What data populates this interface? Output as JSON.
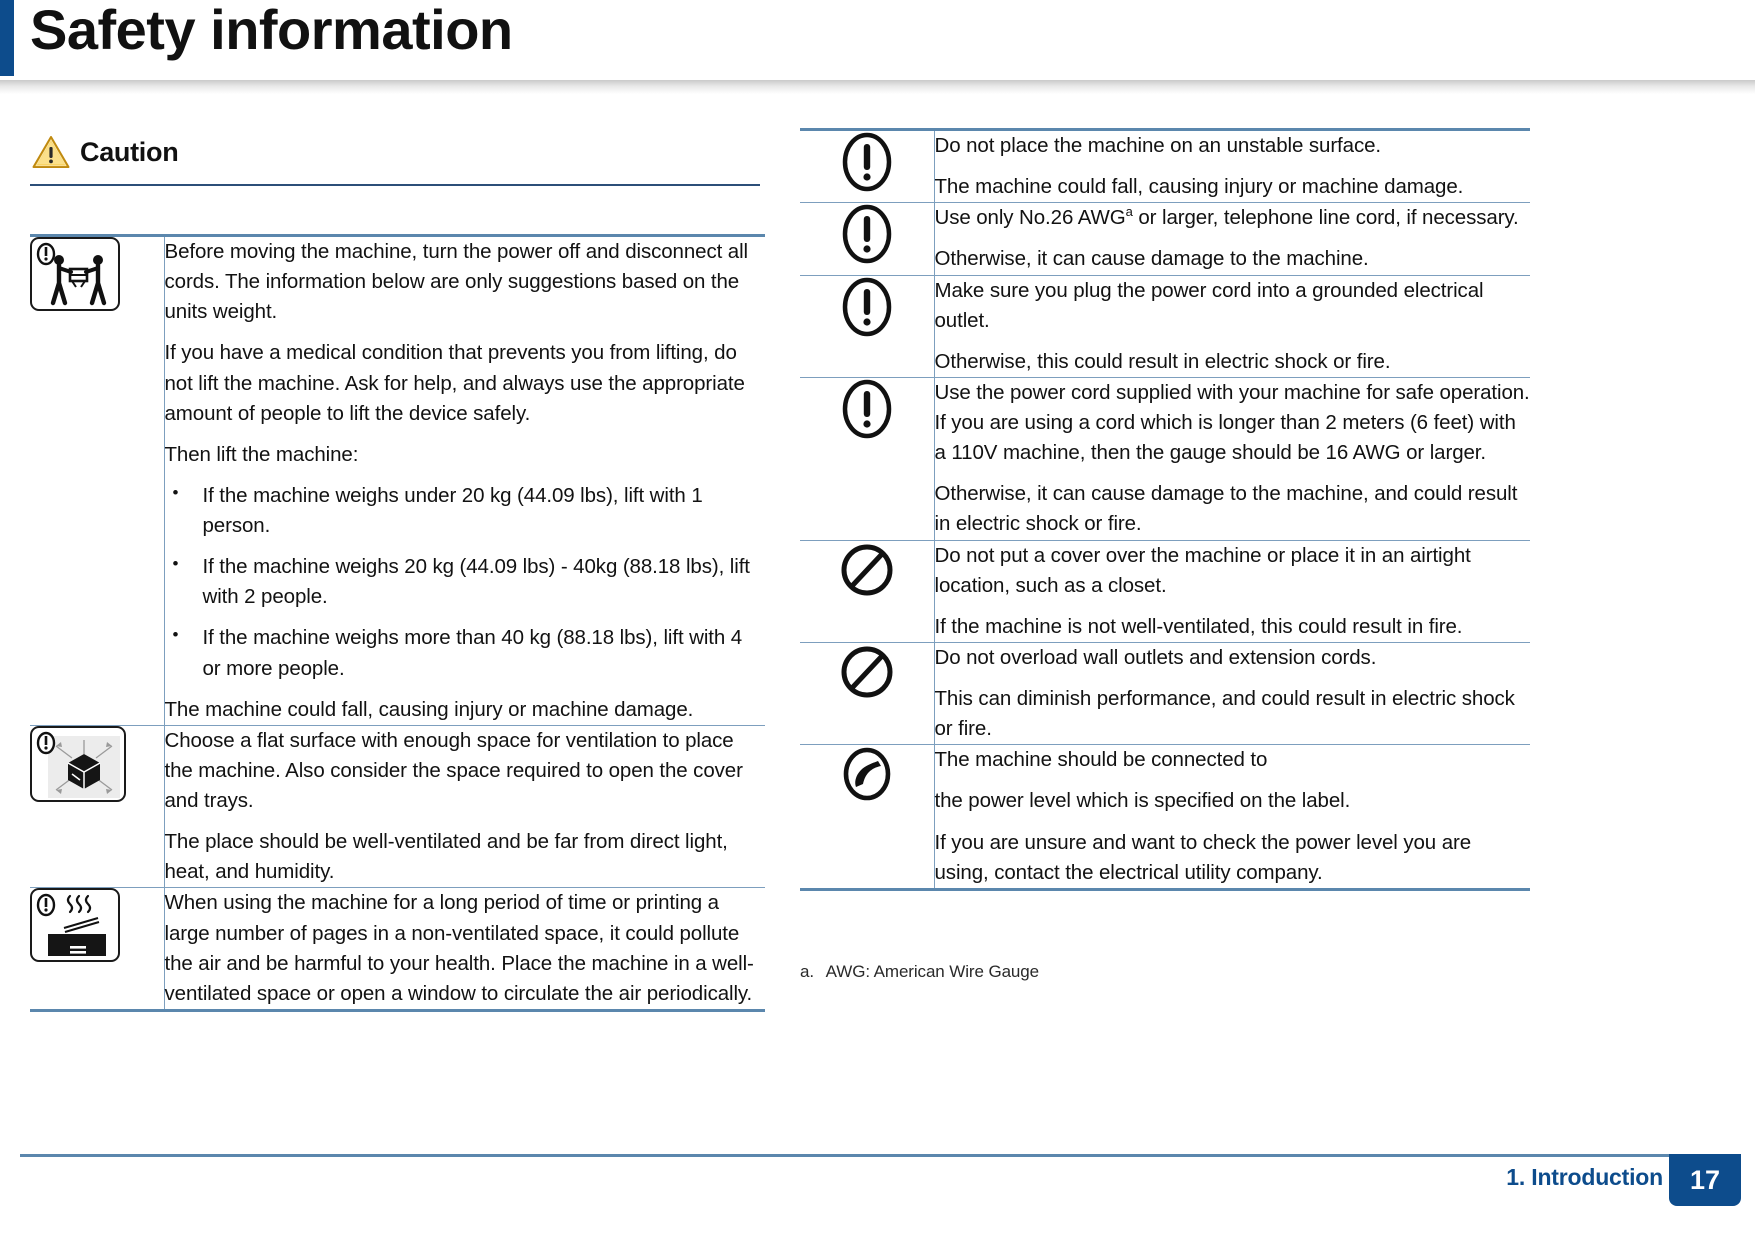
{
  "header": {
    "title": "Safety information"
  },
  "caution": {
    "label": "Caution",
    "icon": "warning-triangle-icon"
  },
  "left_table": {
    "rows": [
      {
        "icon": "two-person-lift-icon",
        "paragraphs": [
          "Before moving the machine, turn the power off and disconnect all cords. The information below are only suggestions based on the units weight.",
          "If you have a medical condition that prevents you from lifting, do not lift the machine. Ask for help, and always use the appropriate amount of people to lift the device safely.",
          "Then lift the machine:"
        ],
        "bullets": [
          "If the machine weighs under 20 kg (44.09 lbs), lift with 1 person.",
          "If the machine weighs 20 kg (44.09 lbs) - 40kg (88.18 lbs), lift with 2 people.",
          "If the machine weighs more than 40 kg (88.18 lbs), lift with 4 or more people."
        ],
        "after_bullets": [
          "The machine could fall, causing injury or machine damage."
        ]
      },
      {
        "icon": "box-clearance-icon",
        "paragraphs": [
          "Choose a flat surface with enough space for ventilation to place the machine. Also consider the space required to open the cover and trays.",
          "The place should be well-ventilated and be far from direct light, heat, and humidity."
        ],
        "bullets": [],
        "after_bullets": []
      },
      {
        "icon": "ventilation-fumes-icon",
        "paragraphs": [
          "When using the machine for a long period of time or printing a large number of pages in a non-ventilated space, it could pollute the air and be harmful to your health. Place the machine in a well-ventilated space or open a window to circulate the air periodically."
        ],
        "bullets": [],
        "after_bullets": []
      }
    ]
  },
  "right_table": {
    "rows": [
      {
        "icon": "exclamation-oval-icon",
        "paragraphs": [
          "Do not place the machine on an unstable surface.",
          "The machine could fall, causing injury or machine damage."
        ]
      },
      {
        "icon": "exclamation-oval-icon",
        "paragraphs": [
          "Use only No.26 AWGa or larger, telephone line cord, if necessary.",
          "Otherwise, it can cause damage to the machine."
        ],
        "sup_note": "a"
      },
      {
        "icon": "exclamation-oval-icon",
        "paragraphs": [
          "Make sure you plug the power cord into a grounded electrical outlet.",
          "Otherwise, this could result in electric shock or fire."
        ]
      },
      {
        "icon": "exclamation-oval-icon",
        "paragraphs": [
          "Use the power cord supplied with your machine for safe operation. If you are using a cord which is longer than 2 meters (6 feet) with a 110V machine, then the gauge should be 16 AWG or larger.",
          "Otherwise, it can cause damage to the machine, and could result in electric shock or fire."
        ]
      },
      {
        "icon": "prohibition-icon",
        "paragraphs": [
          "Do not put a cover over the machine or place it in an airtight location, such as a closet.",
          "If the machine is not well-ventilated, this could result in fire."
        ]
      },
      {
        "icon": "prohibition-icon",
        "paragraphs": [
          "Do not overload wall outlets and extension cords.",
          "This can diminish performance, and could result in electric shock or fire."
        ]
      },
      {
        "icon": "no-telephone-handset-icon",
        "paragraphs": [
          "The machine should be connected to",
          "the power level which is specified on the label.",
          "If you are unsure and want to check the power level you are using, contact the electrical utility company."
        ]
      }
    ]
  },
  "footnote": {
    "mark": "a.",
    "text": "AWG: American Wire Gauge"
  },
  "footer": {
    "chapter": "1. Introduction",
    "page": "17"
  },
  "colors": {
    "brand_blue": "#0d4c8c",
    "rule_blue": "#5b87ad",
    "thin_rule_blue": "#7d9fbe",
    "heading_rule": "#2c4f79",
    "caution_yellow": "#f2c230"
  }
}
